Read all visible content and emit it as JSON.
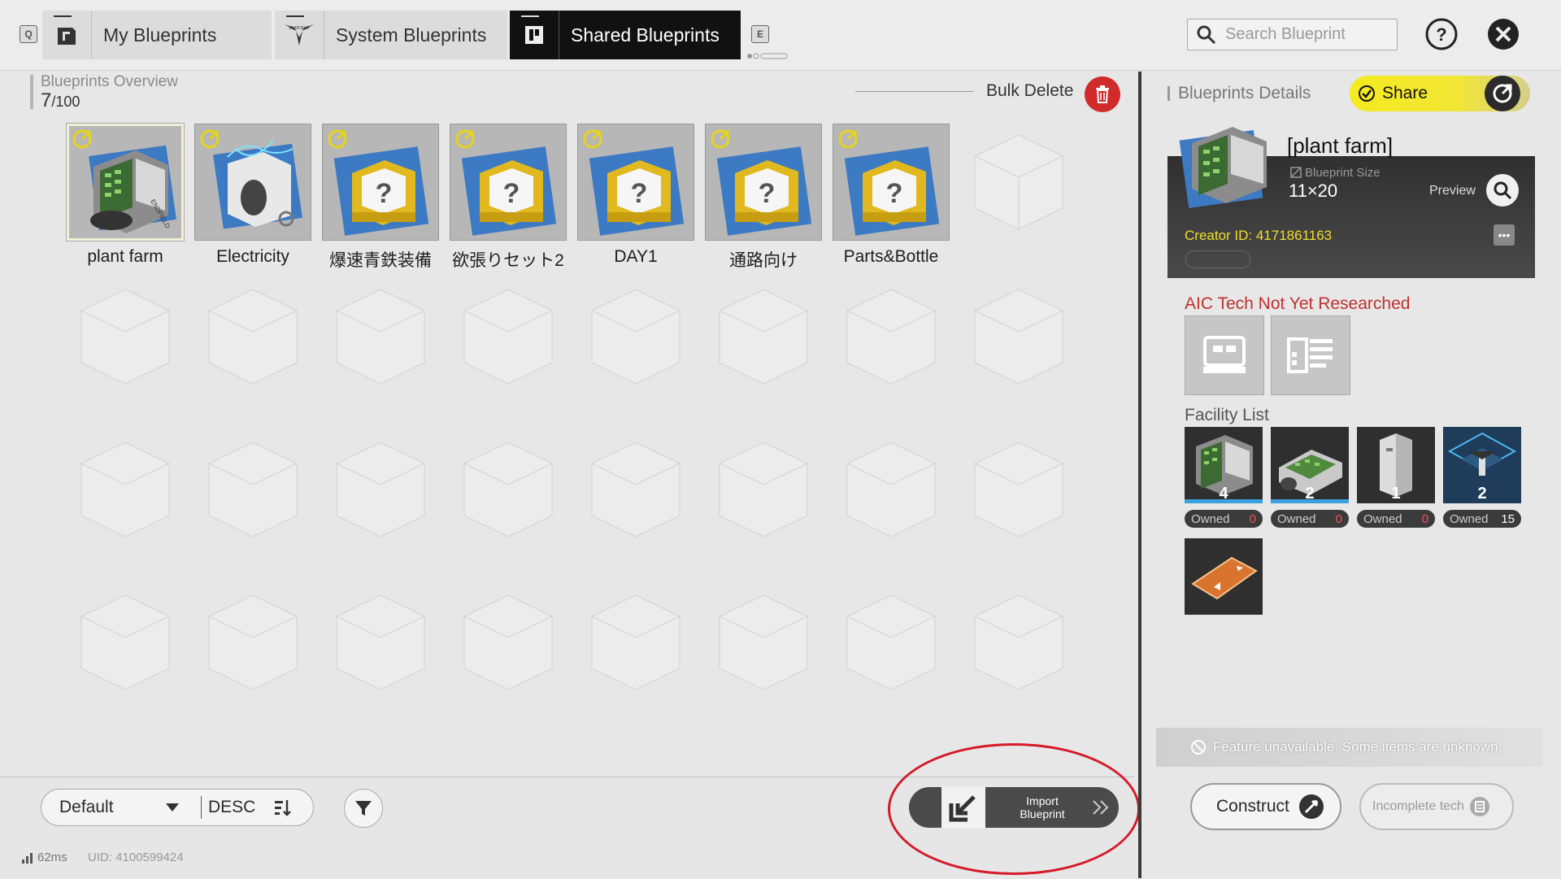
{
  "header": {
    "tabs": [
      {
        "label": "My Blueprints",
        "icon": "blueprint-doc-icon",
        "active": false
      },
      {
        "label": "System Blueprints",
        "icon": "endfield-logo-icon",
        "active": false
      },
      {
        "label": "Shared Blueprints",
        "icon": "shared-blueprint-icon",
        "active": true
      }
    ],
    "left_key": "Q",
    "right_key": "E",
    "search_placeholder": "Search Blueprint"
  },
  "overview": {
    "title": "Blueprints Overview",
    "count": "7",
    "capacity": "/100",
    "bulk_delete": "Bulk Delete"
  },
  "blueprints": [
    {
      "name": "plant farm",
      "kind": "plant"
    },
    {
      "name": "Electricity",
      "kind": "power"
    },
    {
      "name": "爆速青鉄装備",
      "kind": "unknown"
    },
    {
      "name": "欲張りセット2",
      "kind": "unknown"
    },
    {
      "name": "DAY1",
      "kind": "unknown"
    },
    {
      "name": "通路向け",
      "kind": "unknown"
    },
    {
      "name": "Parts&Bottle",
      "kind": "unknown"
    }
  ],
  "sort": {
    "selected": "Default",
    "order": "DESC"
  },
  "import_button": {
    "line1": "Import",
    "line2": "Blueprint"
  },
  "status": {
    "ping": "62ms",
    "uid": "UID: 4100599424"
  },
  "details": {
    "title": "Blueprints Details",
    "share_label": "Share",
    "name": "[plant farm]",
    "size_label": "Blueprint Size",
    "size": "11×20",
    "preview_label": "Preview",
    "creator": "Creator ID: 4171861163",
    "tech_title": "AIC Tech Not Yet Researched",
    "facility_title": "Facility List",
    "facilities": [
      {
        "count": "4",
        "owned_label": "Owned",
        "owned": "0"
      },
      {
        "count": "2",
        "owned_label": "Owned",
        "owned": "0"
      },
      {
        "count": "1",
        "owned_label": "Owned",
        "owned": "0"
      },
      {
        "count": "2",
        "owned_label": "Owned",
        "owned": "15"
      }
    ],
    "unavailable": "Feature unavailable. Some items are unknown.",
    "construct": "Construct",
    "incomplete": "Incomplete tech"
  },
  "colors": {
    "accent_yellow": "#f5eb1f",
    "delete_red": "#d12a2a",
    "warning_red": "#c03030",
    "annotation_red": "#d51a2a"
  }
}
